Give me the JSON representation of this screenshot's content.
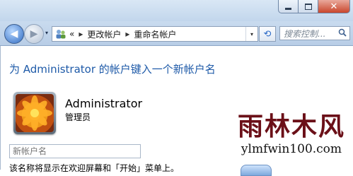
{
  "window": {
    "min_label": "minimize",
    "max_label": "maximize",
    "close_glyph": "✕"
  },
  "nav": {
    "back_glyph": "◀",
    "forward_glyph": "▶",
    "history_glyph": "▾",
    "breadcrumb_lead": "«",
    "crumbs": [
      "更改帐户",
      "重命名帐户"
    ],
    "crumb_sep": "▸",
    "refresh_glyph": "⟲",
    "search_placeholder": "搜索控制...",
    "search_icon": "magnifier-icon"
  },
  "main": {
    "heading": "为 Administrator 的帐户键入一个新帐户名",
    "user": {
      "name": "Administrator",
      "role": "管理员",
      "avatar_icon": "orange-flower-avatar"
    },
    "new_name_placeholder": "新帐户名",
    "hint": "该名称将显示在欢迎屏幕和「开始」菜单上。"
  },
  "watermark": {
    "cn": "雨林木风",
    "en": "ylmfwin100.com"
  },
  "colors": {
    "heading": "#1e5aa8",
    "watermark_cn": "#6b1018"
  }
}
